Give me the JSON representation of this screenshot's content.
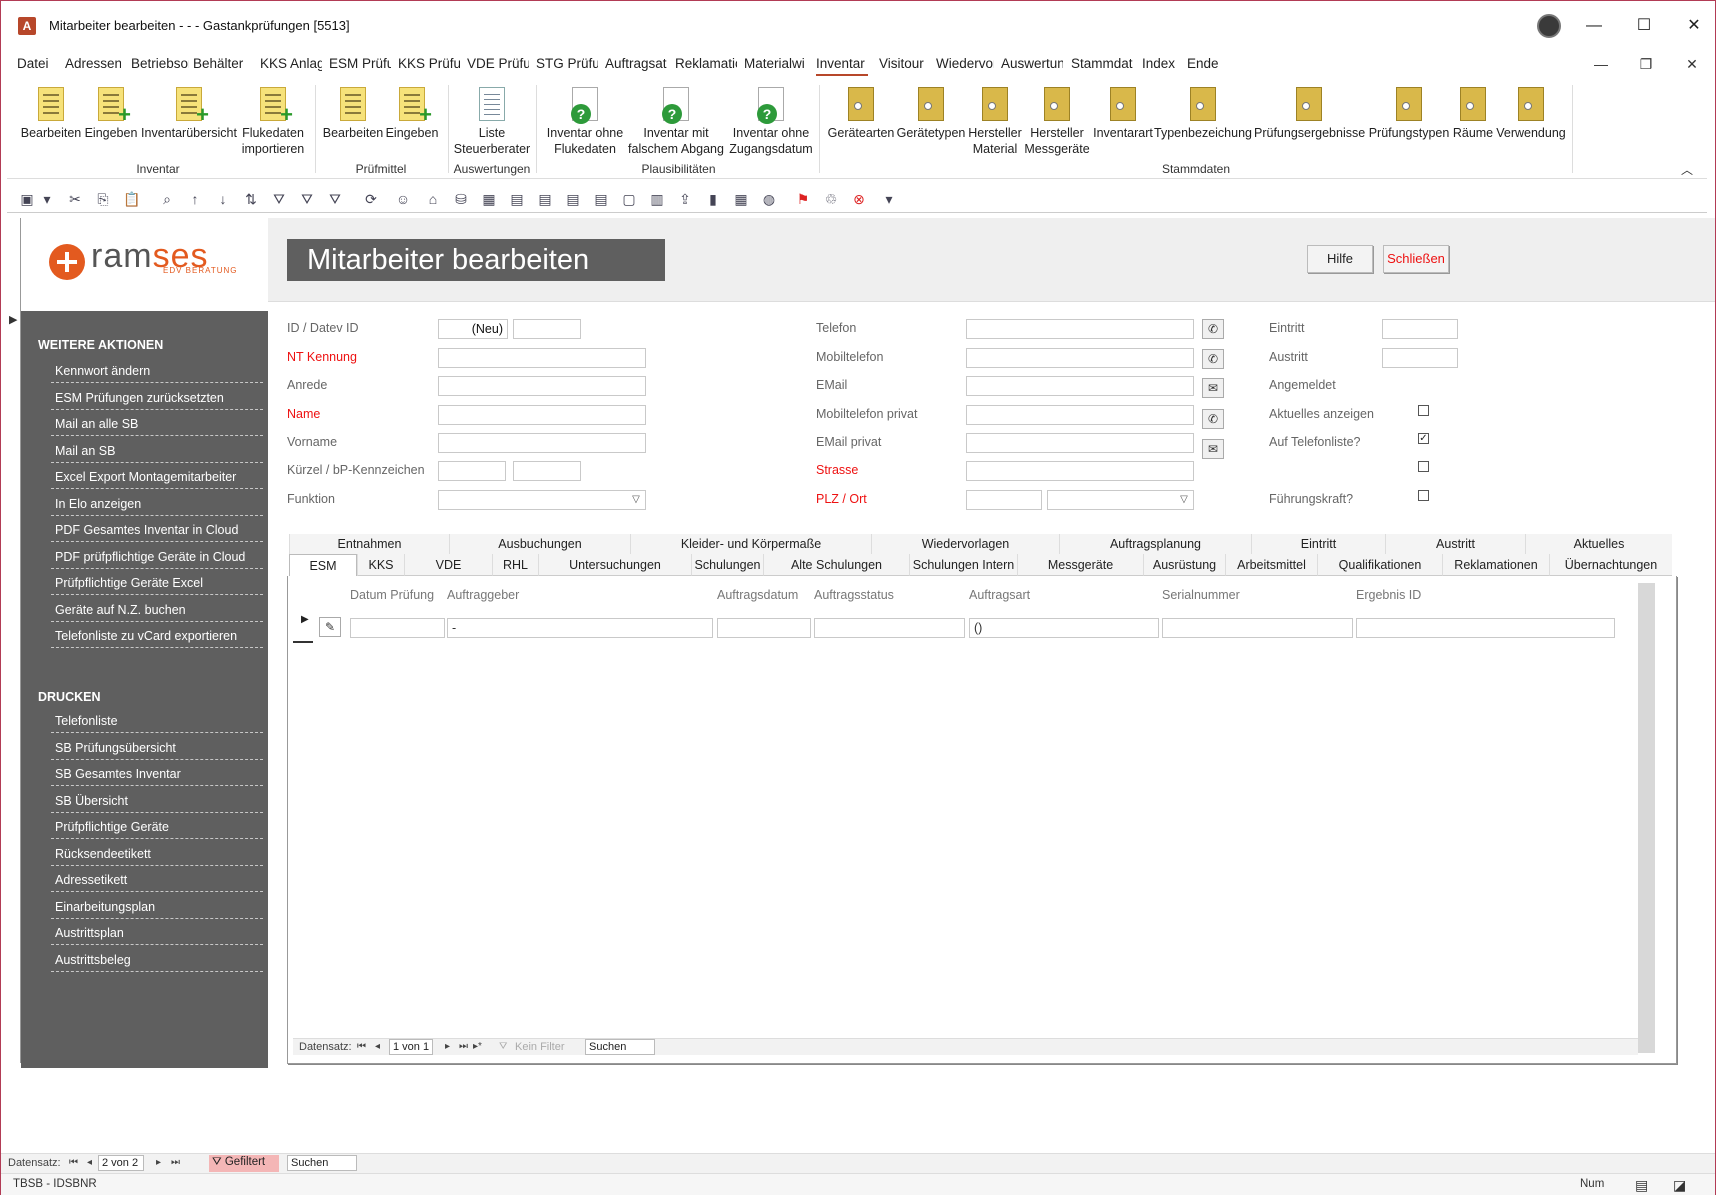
{
  "window": {
    "title": "Mitarbeiter bearbeiten -  -  -  Gastankprüfungen [5513]",
    "app_icon": "A"
  },
  "menu": [
    "Datei",
    "Adressen",
    "Betriebsor",
    "Behälter",
    "KKS Anlag",
    "ESM Prüfu",
    "KKS Prüfur",
    "VDE Prüfui",
    "STG Prüfur",
    "Auftragsat",
    "Reklamatic",
    "Materialwi",
    "Inventar",
    "Visitour",
    "Wiedervor",
    "Auswertun",
    "Stammdat",
    "Index",
    "Ende"
  ],
  "ribbon": {
    "buttons": [
      {
        "label": "Bearbeiten",
        "l2": "",
        "icon": "doc-icon"
      },
      {
        "label": "Eingeben",
        "l2": "",
        "icon": "doc-add-icon"
      },
      {
        "label": "Inventarübersicht",
        "l2": "",
        "icon": "doc-add-icon"
      },
      {
        "label": "Flukedaten",
        "l2": "importieren",
        "icon": "doc-add-icon"
      },
      {
        "label": "Bearbeiten",
        "l2": "",
        "icon": "doc-icon"
      },
      {
        "label": "Eingeben",
        "l2": "",
        "icon": "doc-add-icon"
      },
      {
        "label": "Liste",
        "l2": "Steuerberater",
        "icon": "report-icon"
      },
      {
        "label": "Inventar ohne",
        "l2": "Flukedaten",
        "icon": "query-icon"
      },
      {
        "label": "Inventar mit",
        "l2": "falschem Abgang",
        "icon": "query-icon"
      },
      {
        "label": "Inventar ohne",
        "l2": "Zugangsdatum",
        "icon": "query-icon"
      },
      {
        "label": "Gerätearten",
        "l2": "",
        "icon": "folder-icon"
      },
      {
        "label": "Gerätetypen",
        "l2": "",
        "icon": "folder-icon"
      },
      {
        "label": "Hersteller",
        "l2": "Material",
        "icon": "folder-icon"
      },
      {
        "label": "Hersteller",
        "l2": "Messgeräte",
        "icon": "folder-icon"
      },
      {
        "label": "Inventarart",
        "l2": "",
        "icon": "folder-icon"
      },
      {
        "label": "Typenbezeichung",
        "l2": "",
        "icon": "folder-icon"
      },
      {
        "label": "Prüfungsergebnisse",
        "l2": "",
        "icon": "folder-icon"
      },
      {
        "label": "Prüfungstypen",
        "l2": "",
        "icon": "folder-icon"
      },
      {
        "label": "Räume",
        "l2": "",
        "icon": "folder-icon"
      },
      {
        "label": "Verwendung",
        "l2": "",
        "icon": "folder-icon"
      }
    ],
    "groups": [
      "Inventar",
      "Prüfmittel",
      "Auswertungen",
      "Plausibilitäten",
      "Stammdaten"
    ]
  },
  "form": {
    "title": "Mitarbeiter bearbeiten",
    "help_label": "Hilfe",
    "close_label": "Schließen",
    "logo_text_a": "ram",
    "logo_text_b": "ses",
    "logo_sub": "EDV BERATUNG"
  },
  "sidebar": {
    "actions_heading": "WEITERE AKTIONEN",
    "actions": [
      "Kennwort ändern",
      "ESM Prüfungen zurücksetzten",
      "Mail an alle SB",
      "Mail an SB",
      "Excel Export Montagemitarbeiter",
      "In Elo anzeigen",
      "PDF Gesamtes Inventar in Cloud",
      "PDF prüfpflichtige Geräte in Cloud",
      "Prüfpflichtige Geräte Excel",
      "Geräte auf N.Z. buchen",
      "Telefonliste zu vCard exportieren"
    ],
    "print_heading": "DRUCKEN",
    "print": [
      "Telefonliste",
      "SB Prüfungsübersicht",
      "SB Gesamtes Inventar",
      "SB Übersicht",
      "Prüfpflichtige Geräte",
      "Rücksendeetikett",
      "Adressetikett",
      "Einarbeitungsplan",
      "Austrittsplan",
      "Austrittsbeleg"
    ]
  },
  "fields": {
    "id_label": "ID / Datev ID",
    "id_value": "(Neu)",
    "nt_label": "NT Kennung",
    "anrede_label": "Anrede",
    "name_label": "Name",
    "vorname_label": "Vorname",
    "kuerzel_label": "Kürzel / bP-Kennzeichen",
    "funktion_label": "Funktion",
    "telefon_label": "Telefon",
    "mobil_label": "Mobiltelefon",
    "email_label": "EMail",
    "mobil_privat_label": "Mobiltelefon privat",
    "email_privat_label": "EMail privat",
    "strasse_label": "Strasse",
    "plz_label": "PLZ / Ort",
    "eintritt_label": "Eintritt",
    "austritt_label": "Austritt",
    "angemeldet_label": "Angemeldet",
    "aktuelles_label": "Aktuelles anzeigen",
    "telefonliste_label": "Auf Telefonliste?",
    "fuehrung_label": "Führungskraft?",
    "telefonliste_checked": true
  },
  "tabs_row1": [
    "Entnahmen",
    "Ausbuchungen",
    "Kleider- und Körpermaße",
    "Wiedervorlagen",
    "Auftragsplanung",
    "Eintritt",
    "Austritt",
    "Aktuelles"
  ],
  "tabs_row2": [
    "ESM",
    "KKS",
    "VDE",
    "RHL",
    "Untersuchungen",
    "Schulungen",
    "Alte Schulungen",
    "Schulungen Intern",
    "Messgeräte",
    "Ausrüstung",
    "Arbeitsmittel",
    "Qualifikationen",
    "Reklamationen",
    "Übernachtungen"
  ],
  "subform": {
    "columns": [
      "Datum Prüfung",
      "Auftraggeber",
      "Auftragsdatum",
      "Auftragsstatus",
      "Auftragsart",
      "Serialnummer",
      "Ergebnis ID"
    ],
    "row": [
      "",
      "-",
      "",
      "",
      "()",
      "",
      ""
    ],
    "nav_label": "Datensatz:",
    "nav_pos": "1 von 1",
    "filter_label": "Kein Filter",
    "search_label": "Suchen"
  },
  "bottom_nav": {
    "label": "Datensatz:",
    "pos": "2 von 2",
    "filter_label": "Gefiltert",
    "search_label": "Suchen"
  },
  "status": {
    "left": "TBSB - IDSBNR",
    "num": "Num"
  }
}
